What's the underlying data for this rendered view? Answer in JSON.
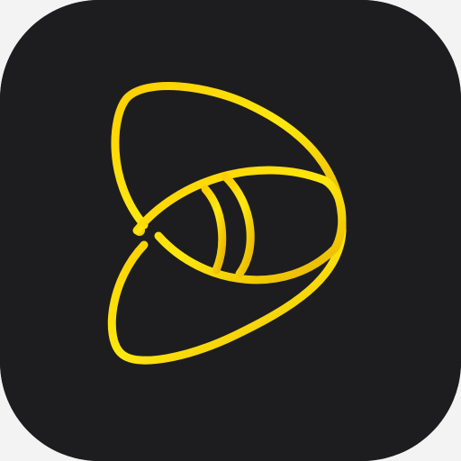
{
  "app_icon": {
    "glyph": "stylized-eye-play-icon",
    "background_color": "#1d1d1f",
    "stroke_gradient": [
      "#ffce00",
      "#ffe80f",
      "#e7b300"
    ]
  }
}
